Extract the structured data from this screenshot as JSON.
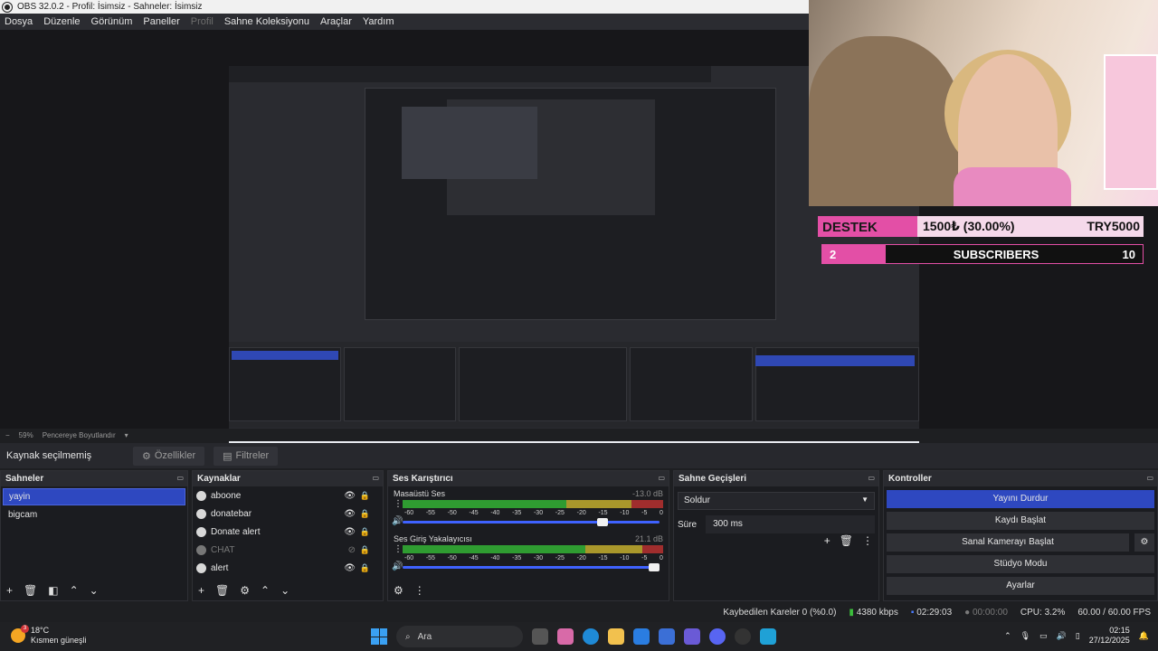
{
  "window": {
    "title": "OBS 32.0.2 - Profil: İsimsiz - Sahneler: İsimsiz"
  },
  "menu": [
    "Dosya",
    "Düzenle",
    "Görünüm",
    "Paneller",
    "Profil",
    "Sahne Koleksiyonu",
    "Araçlar",
    "Yardım"
  ],
  "overlay": {
    "destek_label": "DESTEK",
    "destek_amount": "1500₺ (30.00%)",
    "destek_goal": "TRY5000",
    "subs_count": "2",
    "subs_label": "SUBSCRIBERS",
    "subs_goal": "10",
    "accent_color": "#e34fa6"
  },
  "zoom": {
    "minus": "−",
    "value": "59%",
    "label": "Pencereye Boyutlandır"
  },
  "source_bar": {
    "status": "Kaynak seçilmemiş",
    "properties": "Özellikler",
    "filters": "Filtreler"
  },
  "scenes": {
    "title": "Sahneler",
    "items": [
      {
        "label": "yayin",
        "selected": true
      },
      {
        "label": "bigcam",
        "selected": false
      }
    ]
  },
  "sources": {
    "title": "Kaynaklar",
    "items": [
      {
        "label": "aboone",
        "visible": true
      },
      {
        "label": "donatebar",
        "visible": true
      },
      {
        "label": "Donate alert",
        "visible": true
      },
      {
        "label": "CHAT",
        "visible": false
      },
      {
        "label": "alert",
        "visible": true
      }
    ]
  },
  "mixer": {
    "title": "Ses Karıştırıcı",
    "ticks": [
      "-60",
      "-55",
      "-50",
      "-45",
      "-40",
      "-35",
      "-30",
      "-25",
      "-20",
      "-15",
      "-10",
      "-5",
      "0"
    ],
    "channels": [
      {
        "name": "Masaüstü Ses",
        "db": "-13.0 dB",
        "level": 0.8
      },
      {
        "name": "Ses Giriş Yakalayıcısı",
        "db": "21.1 dB",
        "level": 1.0
      }
    ]
  },
  "transitions": {
    "title": "Sahne Geçişleri",
    "selected": "Soldur",
    "duration_label": "Süre",
    "duration_value": "300 ms"
  },
  "controls": {
    "title": "Kontroller",
    "buttons": [
      "Yayını Durdur",
      "Kaydı Başlat",
      "Sanal Kamerayı Başlat",
      "Stüdyo Modu",
      "Ayarlar"
    ]
  },
  "status": {
    "dropped": "Kaybedilen Kareler 0 (%0.0)",
    "bitrate": "4380 kbps",
    "stream_time": "02:29:03",
    "rec_time": "00:00:00",
    "cpu": "CPU: 3.2%",
    "fps": "60.00 / 60.00 FPS"
  },
  "taskbar": {
    "temp": "18°C",
    "weather": "Kısmen güneşli",
    "weather_badge": "3",
    "search": "Ara",
    "time": "02:15",
    "date": "27/12/2025"
  }
}
